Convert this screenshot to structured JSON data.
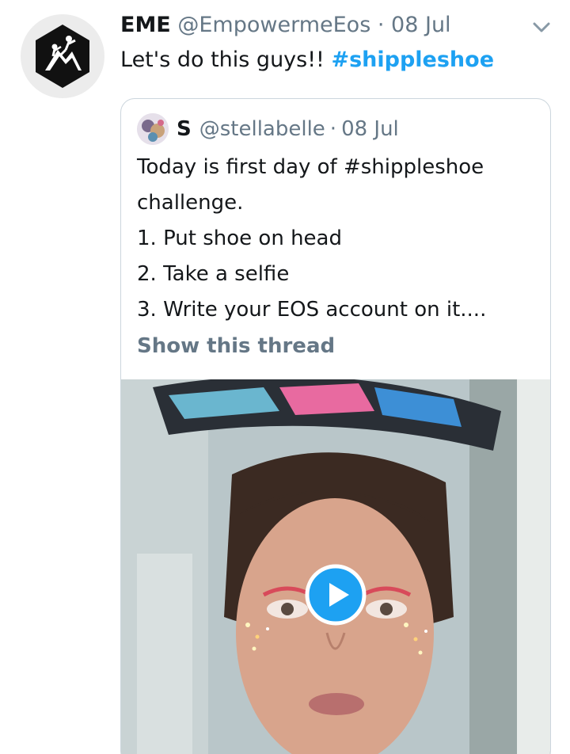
{
  "tweet": {
    "display_name": "EME",
    "handle": "@EmpowermeEos",
    "separator": "·",
    "date": "08 Jul",
    "text_prefix": "Let's do this guys!! ",
    "hashtag": "#shippleshoe",
    "menu_icon": "chevron-down-icon"
  },
  "quote": {
    "display_name": "S",
    "handle": "@stellabelle",
    "separator": "·",
    "date": "08 Jul",
    "lines": [
      "Today is first day of #shippleshoe",
      "challenge.",
      "1. Put shoe on head",
      "2. Take a selfie",
      "3. Write your EOS account on it...."
    ],
    "show_thread": "Show this thread",
    "media": {
      "type": "video",
      "play_icon": "play-icon"
    }
  },
  "colors": {
    "link": "#1da1f2",
    "secondary_text": "#657786",
    "border": "#ccd6dd"
  }
}
